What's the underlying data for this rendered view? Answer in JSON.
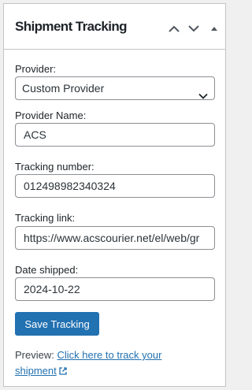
{
  "panel": {
    "title": "Shipment Tracking",
    "icons": [
      "chevron-up-icon",
      "chevron-down-icon",
      "triangle-up-icon"
    ]
  },
  "provider": {
    "label": "Provider:",
    "selected": "Custom Provider"
  },
  "provider_name": {
    "label": "Provider Name:",
    "value": "ACS"
  },
  "tracking_number": {
    "label": "Tracking number:",
    "value": "012498982340324"
  },
  "tracking_link": {
    "label": "Tracking link:",
    "value": "https://www.acscourier.net/el/web/gr"
  },
  "date_shipped": {
    "label": "Date shipped:",
    "value": "2024-10-22"
  },
  "save_button": {
    "label": "Save Tracking"
  },
  "preview": {
    "label": "Preview:",
    "link_text": "Click here to track your shipment"
  },
  "colors": {
    "accent": "#2271b1",
    "border": "#c3c4c7",
    "text": "#1d2327"
  }
}
